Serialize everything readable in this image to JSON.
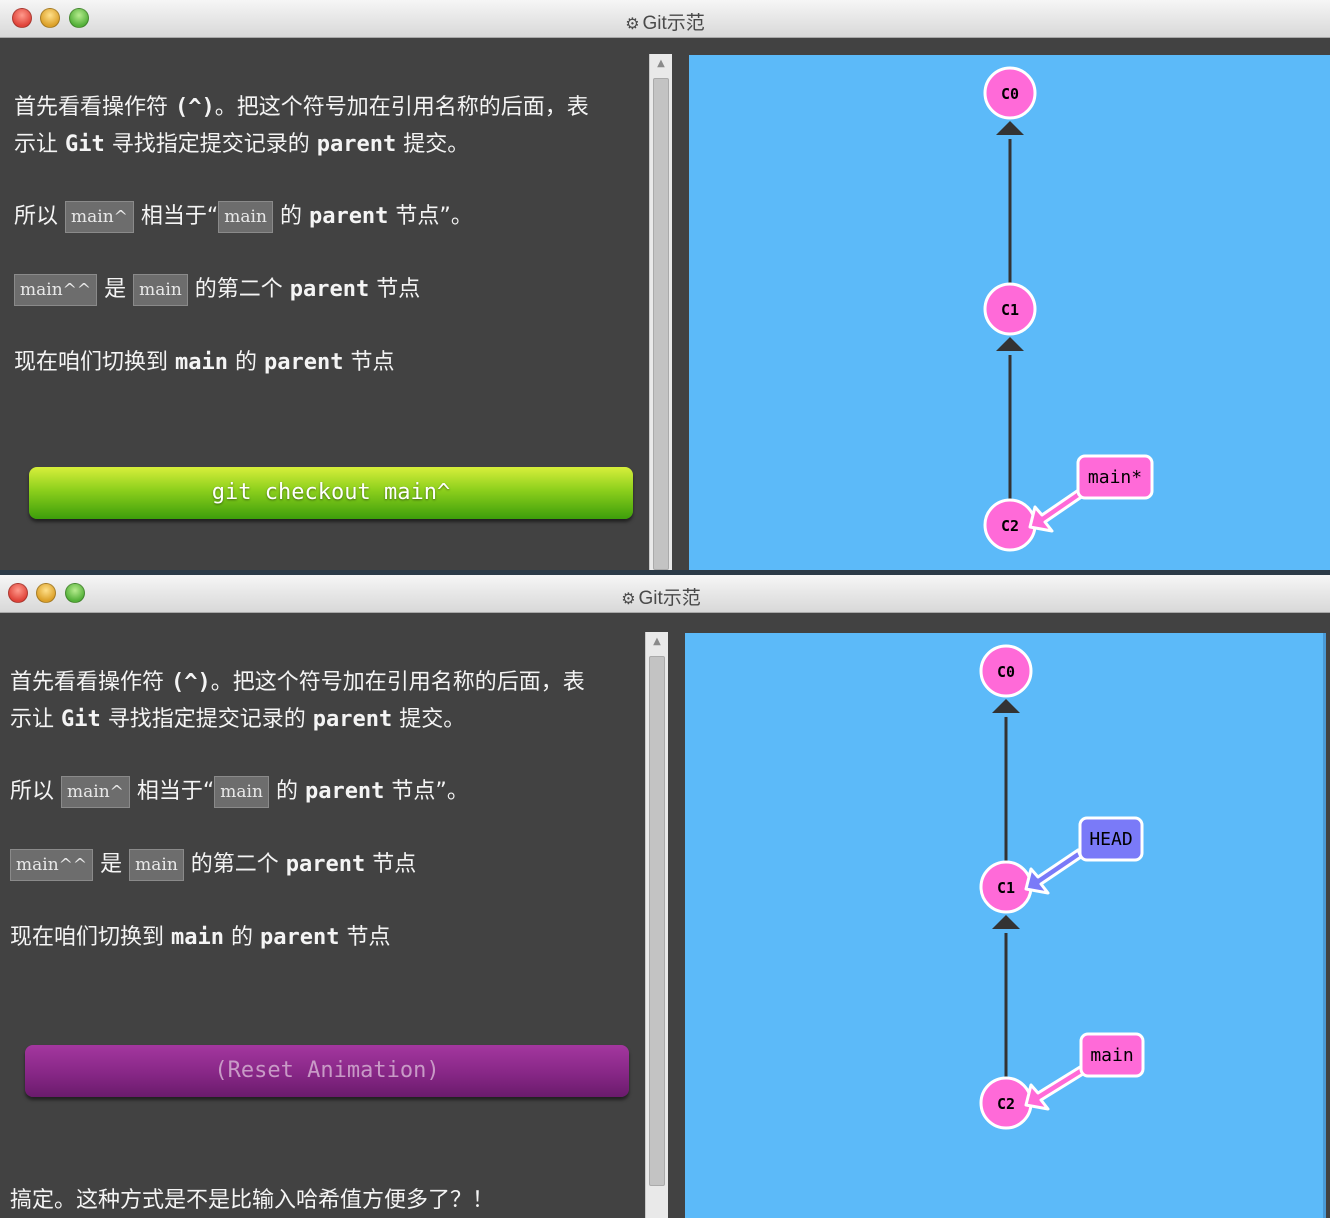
{
  "windows": [
    {
      "title": "Git示范",
      "paragraphs": {
        "p1_line1": [
          "首先看看操作符 ",
          "(^)",
          "。把这个符号加在引用名称的后面，表"
        ],
        "p1_line2": [
          "示让 ",
          "Git",
          " 寻找指定提交记录的 ",
          "parent",
          " 提交。"
        ],
        "p2": [
          "所以 ",
          "main^",
          " 相当于“",
          "main",
          " 的 ",
          "parent",
          " 节点”。"
        ],
        "p3": [
          "main^^",
          " 是 ",
          "main",
          " 的第二个 ",
          "parent",
          " 节点"
        ],
        "p4": [
          "现在咱们切换到 ",
          "main",
          " 的 ",
          "parent",
          " 节点"
        ]
      },
      "button_label": "git checkout main^",
      "graph": {
        "nodes": [
          "C0",
          "C1",
          "C2"
        ],
        "branches": [
          {
            "label": "main*",
            "target": "C2"
          }
        ]
      }
    },
    {
      "title": "Git示范",
      "paragraphs": {
        "p1_line1": [
          "首先看看操作符 ",
          "(^)",
          "。把这个符号加在引用名称的后面，表"
        ],
        "p1_line2": [
          "示让 ",
          "Git",
          " 寻找指定提交记录的 ",
          "parent",
          " 提交。"
        ],
        "p2": [
          "所以 ",
          "main^",
          " 相当于“",
          "main",
          " 的 ",
          "parent",
          " 节点”。"
        ],
        "p3": [
          "main^^",
          " 是 ",
          "main",
          " 的第二个 ",
          "parent",
          " 节点"
        ],
        "p4": [
          "现在咱们切换到 ",
          "main",
          " 的 ",
          "parent",
          " 节点"
        ],
        "p5": "搞定。这种方式是不是比输入哈希值方便多了？！"
      },
      "button_label": "(Reset Animation)",
      "graph": {
        "nodes": [
          "C0",
          "C1",
          "C2"
        ],
        "branches": [
          {
            "label": "HEAD",
            "target": "C1"
          },
          {
            "label": "main",
            "target": "C2"
          }
        ]
      }
    }
  ],
  "colors": {
    "canvas_bg": "#5cbaf9",
    "node_fill": "#ff6ad8",
    "branch_main": "#ff6ad8",
    "branch_head": "#7a7af8",
    "button_green": "#7ac418",
    "button_purple": "#8a2a88"
  },
  "icons": {
    "title_icon": "gear-icon"
  }
}
